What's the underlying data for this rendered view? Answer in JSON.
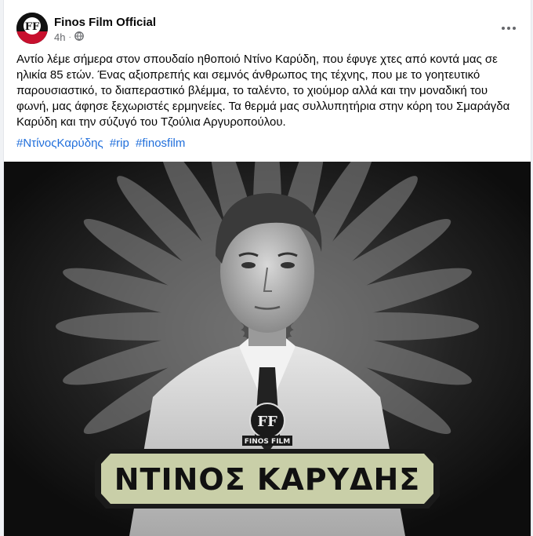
{
  "post": {
    "page_name": "Finos Film Official",
    "time": "4h",
    "body": "Αντίο λέμε σήμερα στον σπουδαίο ηθοποιό Ντίνο Καρύδη, που έφυγε χτες από κοντά μας σε ηλικία 85 ετών. Ένας αξιοπρεπής και σεμνός άνθρωπος της τέχνης, που με το γοητευτικό παρουσιαστικό, το διαπεραστικό βλέμμα, το ταλέντο, το χιούμορ αλλά και την μοναδική του φωνή, μας άφησε ξεχωριστές ερμηνείες. Τα θερμά μας συλλυπητήρια στην κόρη του Σμαράγδα Καρύδη και την σύζυγό του Τζούλια Αργυροπούλου.",
    "hashtags": [
      "#ΝτίνοςΚαρύδης",
      "#rip",
      "#finosfilm"
    ]
  },
  "image": {
    "logo_text": "FINOS FILM",
    "logo_monogram": "FF",
    "nameplate": "ΝΤΙΝΟΣ ΚΑΡΥΔΗΣ"
  },
  "icons": {
    "privacy": "globe-icon",
    "more": "more-horizontal-icon"
  },
  "colors": {
    "link": "#216fdb",
    "nameplate_bg": "#c9cfa8",
    "text_secondary": "#65676b"
  }
}
